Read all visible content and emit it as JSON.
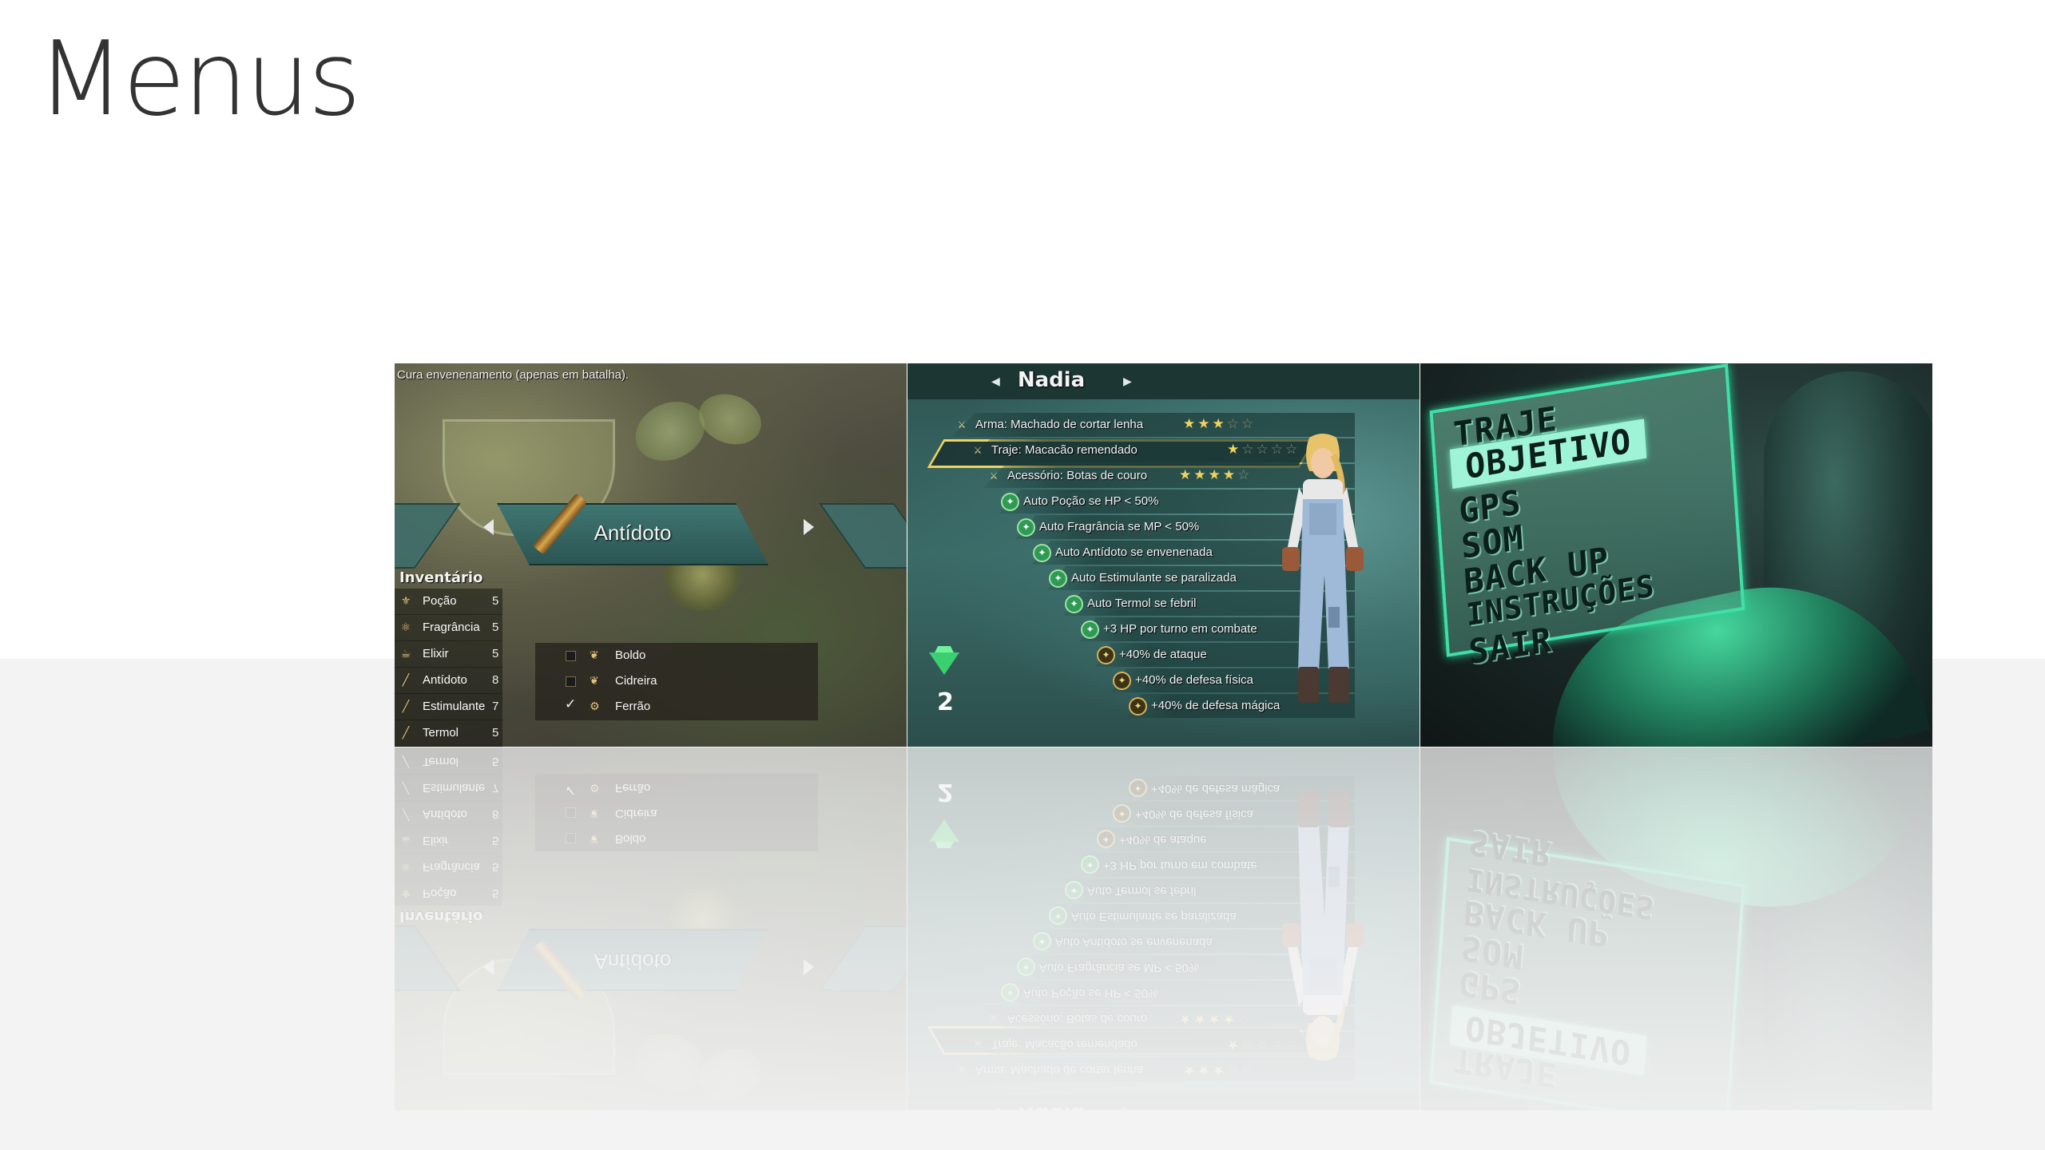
{
  "page": {
    "title": "Menus"
  },
  "inventory": {
    "description": "Cura envenenamento (apenas em batalha).",
    "selected_item": "Antídoto",
    "title": "Inventário",
    "items": [
      {
        "name": "Poção",
        "qty": "5",
        "icon": "potion-icon"
      },
      {
        "name": "Fragrância",
        "qty": "5",
        "icon": "fragrance-icon"
      },
      {
        "name": "Elixir",
        "qty": "5",
        "icon": "elixir-icon"
      },
      {
        "name": "Antídoto",
        "qty": "8",
        "icon": "antidote-icon"
      },
      {
        "name": "Estimulante",
        "qty": "7",
        "icon": "stimulant-icon"
      },
      {
        "name": "Termol",
        "qty": "5",
        "icon": "termol-icon"
      }
    ],
    "ingredients": [
      {
        "name": "Boldo",
        "checked": false
      },
      {
        "name": "Cidreira",
        "checked": false
      },
      {
        "name": "Ferrão",
        "checked": true
      }
    ]
  },
  "character": {
    "name": "Nadia",
    "equipment": [
      {
        "label": "Arma: Machado de cortar lenha",
        "stars": 3
      },
      {
        "label": "Traje: Macacão remendado",
        "stars": 1
      },
      {
        "label": "Acessório: Botas de couro",
        "stars": 4
      }
    ],
    "max_stars": 5,
    "skills": [
      "Auto Poção se HP < 50%",
      "Auto Fragrância se MP < 50%",
      "Auto Antídoto se envenenada",
      "Auto Estimulante se paralizada",
      "Auto Termol se febril",
      "+3 HP por turno em combate",
      "+40% de ataque",
      "+40% de defesa física",
      "+40% de defesa mágica"
    ],
    "gem_count": "2",
    "colors": {
      "star_on": "#f0d25c",
      "highlight": "#f0d25c",
      "skill_green": "#2f9a55"
    }
  },
  "main_menu": {
    "items": [
      "TRAJE",
      "OBJETIVO",
      "GPS",
      "SOM",
      "BACK UP",
      "INSTRUÇÕES",
      "SAIR"
    ],
    "selected": "OBJETIVO",
    "colors": {
      "accent": "#3fe0a8"
    }
  }
}
